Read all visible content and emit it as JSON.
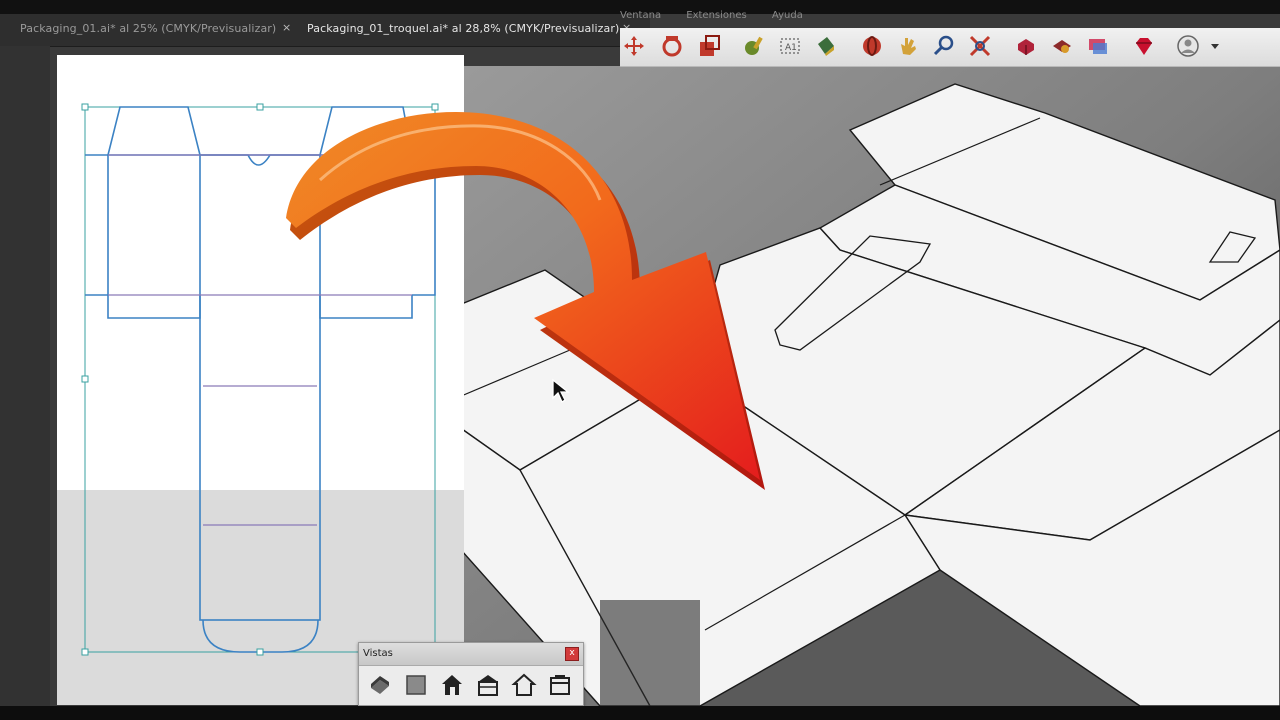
{
  "tabs": [
    {
      "label": "Packaging_01.ai* al 25% (CMYK/Previsualizar)",
      "active": false
    },
    {
      "label": "Packaging_01_troquel.ai* al 28,8% (CMYK/Previsualizar)",
      "active": true
    }
  ],
  "tab_close_glyph": "×",
  "menu_items": [
    "Ventana",
    "Extensiones",
    "Ayuda"
  ],
  "toolbar_icons": [
    "move-icon",
    "rotate-icon",
    "scale-icon",
    "tape-measure-icon",
    "text-icon",
    "paint-bucket-icon",
    "orbit-icon",
    "pan-icon",
    "zoom-icon",
    "zoom-extents-icon",
    "component-icon",
    "material-icon",
    "layer-icon",
    "ruby-icon",
    "user-account-icon"
  ],
  "vistas": {
    "title": "Vistas",
    "close_glyph": "x",
    "buttons": [
      "iso-view-icon",
      "top-view-icon",
      "front-view-icon",
      "right-view-icon",
      "back-view-icon",
      "left-view-icon"
    ]
  },
  "colors": {
    "dieline_blue": "#3b82c4",
    "dieline_purple": "#8a7ab8",
    "arrow_orange": "#f07a1a",
    "arrow_red": "#e8261e",
    "panel_dark": "#2e2e2e"
  }
}
